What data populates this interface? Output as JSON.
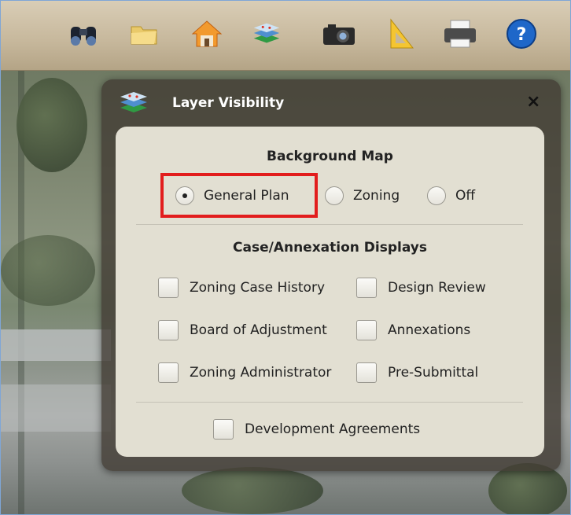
{
  "toolbar": {
    "tools": [
      {
        "icon": "binoculars-icon"
      },
      {
        "icon": "folder-icon"
      },
      {
        "icon": "home-icon"
      },
      {
        "icon": "layers-icon"
      },
      {
        "icon": "camera-icon"
      },
      {
        "icon": "ruler-triangle-icon"
      },
      {
        "icon": "printer-icon"
      },
      {
        "icon": "help-icon"
      }
    ]
  },
  "panel": {
    "title": "Layer Visibility",
    "close": "×",
    "background_map": {
      "heading": "Background Map",
      "options": [
        {
          "label": "General Plan",
          "selected": true
        },
        {
          "label": "Zoning",
          "selected": false
        },
        {
          "label": "Off",
          "selected": false
        }
      ]
    },
    "case_displays": {
      "heading": "Case/Annexation Displays",
      "left": [
        "Zoning Case History",
        "Board of Adjustment",
        "Zoning Administrator"
      ],
      "right": [
        "Design Review",
        "Annexations",
        "Pre-Submittal"
      ],
      "bottom": "Development Agreements"
    }
  },
  "colors": {
    "highlight": "#e21d1d",
    "panel_bg": "#e2dfd2",
    "toolbar": "#c6b79b"
  }
}
